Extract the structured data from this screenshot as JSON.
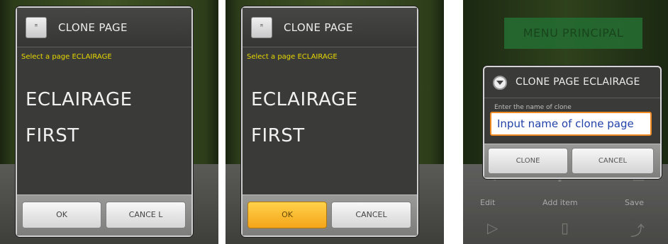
{
  "panel1": {
    "dialog_icon": "ꟸ",
    "title": "CLONE PAGE",
    "subtitle": "Select a page ECLAIRAGE",
    "items": [
      "ECLAIRAGE",
      "FIRST"
    ],
    "ok_label": "OK",
    "cancel_label": "CANCE L"
  },
  "panel2": {
    "dialog_icon": "ꟸ",
    "title": "CLONE PAGE",
    "subtitle": "Select a page ECLAIRAGE",
    "items": [
      "ECLAIRAGE",
      "FIRST"
    ],
    "ok_label": "OK",
    "cancel_label": "CANCEL",
    "ok_state": "pressed"
  },
  "panel3": {
    "menu_title": "MENU PRINCIPAL",
    "dialog": {
      "title": "CLONE PAGE ECLAIRAGE",
      "label": "Enter the name of clone",
      "input_value": "Input name of clone page",
      "clone_label": "CLONE",
      "cancel_label": "CANCEL"
    },
    "toolbar": {
      "edit_label": "Edit",
      "add_item_label": "Add item",
      "save_label": "Save"
    }
  },
  "colors": {
    "accent_orange": "#f4a51a",
    "subtitle_yellow": "#e8d800",
    "input_text_blue": "#2242a8",
    "menu_green": "#2f8a3e"
  }
}
